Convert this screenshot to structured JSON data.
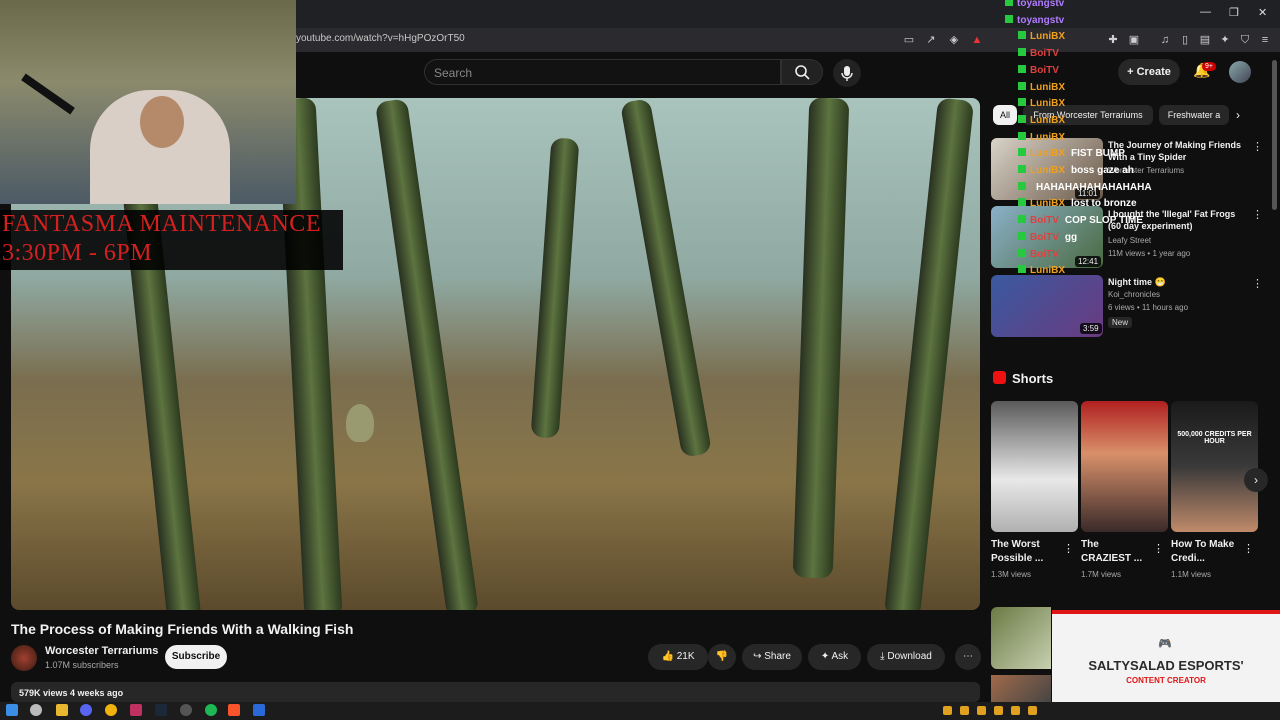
{
  "browser": {
    "url": "youtube.com/watch?v=hHgPOzOrT50",
    "window_controls": [
      "—",
      "❐",
      "✕"
    ]
  },
  "header": {
    "search_placeholder": "Search",
    "create_label": "Create",
    "notification_badge": "9+"
  },
  "stream_overlay": {
    "title_line1": "FANTASMA MAINTENANCE",
    "title_line2": "3:30PM - 6PM"
  },
  "video": {
    "title": "The Process of Making Friends With a Walking Fish",
    "channel_name": "Worcester Terrariums",
    "subscribers": "1.07M subscribers",
    "subscribe_label": "Subscribe",
    "likes": "21K",
    "share_label": "Share",
    "ask_label": "Ask",
    "download_label": "Download",
    "views_date": "579K views  4 weeks ago"
  },
  "sidebar": {
    "chips": [
      "All",
      "From Worcester Terrariums",
      "Freshwater a"
    ],
    "related": [
      {
        "title": "The Journey of Making Friends With a Tiny Spider",
        "channel": "Worcester Terrariums",
        "meta": "",
        "duration": "11:01"
      },
      {
        "title": "I bought the 'Illegal' Fat Frogs (60 day experiment)",
        "channel": "Leafy Street",
        "meta": "11M views • 1 year ago",
        "duration": "12:41"
      },
      {
        "title": "Night time 😁",
        "channel": "Koi_chronicles",
        "meta": "6 views • 11 hours ago",
        "duration": "3:59",
        "badge": "New"
      }
    ],
    "shorts_heading": "Shorts",
    "shorts": [
      {
        "title": "The Worst Possible ...",
        "views": "1.3M views"
      },
      {
        "title": "The CRAZIEST ...",
        "views": "1.7M views"
      },
      {
        "title": "How To Make Credi...",
        "views": "1.1M views"
      }
    ],
    "shorts_thumb_text": "500,000 CREDITS PER HOUR"
  },
  "chat": [
    {
      "user": "toyangstv",
      "color": "#b07bff",
      "msg": ""
    },
    {
      "user": "toyangstv",
      "color": "#b07bff",
      "msg": ""
    },
    {
      "user": "LuniBX",
      "color": "#f0a020",
      "msg": ""
    },
    {
      "user": "BoiTV",
      "color": "#e04040",
      "msg": ""
    },
    {
      "user": "BoiTV",
      "color": "#e04040",
      "msg": ""
    },
    {
      "user": "LuniBX",
      "color": "#f0a020",
      "msg": ""
    },
    {
      "user": "LuniBX",
      "color": "#f0a020",
      "msg": ""
    },
    {
      "user": "LuniBX",
      "color": "#f0a020",
      "msg": ""
    },
    {
      "user": "LuniBX",
      "color": "#f0a020",
      "msg": ""
    },
    {
      "user": "LuniBX",
      "color": "#f0a020",
      "msg": "FIST BUMP"
    },
    {
      "user": "LuniBX",
      "color": "#f0a020",
      "msg": "boss gaze ah"
    },
    {
      "user": "",
      "color": "#f0a020",
      "msg": "HAHAHAHAHAHAHAHA"
    },
    {
      "user": "LuniBX",
      "color": "#f0a020",
      "msg": "lost to bronze"
    },
    {
      "user": "BoiTV",
      "color": "#e04040",
      "msg": "COP SLOP TIME"
    },
    {
      "user": "BoiTV",
      "color": "#e04040",
      "msg": "gg"
    },
    {
      "user": "BoiTV",
      "color": "#e04040",
      "msg": ""
    },
    {
      "user": "LuniBX",
      "color": "#f0a020",
      "msg": ""
    }
  ],
  "sponsor": {
    "name": "SALTYSALAD ESPORTS'",
    "subtitle": "CONTENT CREATOR"
  },
  "colors": {
    "background": "#0f0f0f",
    "accent_red": "#e01515",
    "overlay_red": "#d52020"
  }
}
